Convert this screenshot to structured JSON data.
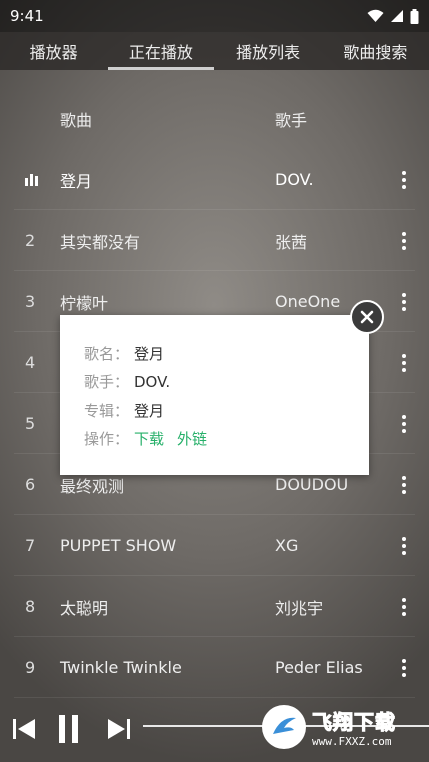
{
  "status_bar": {
    "time": "9:41",
    "icons": [
      "wifi-icon",
      "signal-icon",
      "battery-icon"
    ]
  },
  "tabs": [
    {
      "label": "播放器",
      "active": false
    },
    {
      "label": "正在播放",
      "active": true
    },
    {
      "label": "播放列表",
      "active": false
    },
    {
      "label": "歌曲搜索",
      "active": false
    }
  ],
  "list": {
    "header": {
      "song": "歌曲",
      "artist": "歌手"
    },
    "rows": [
      {
        "index": "",
        "song": "登月",
        "artist": "DOV.",
        "playing": true
      },
      {
        "index": "2",
        "song": "其实都没有",
        "artist": "张茜"
      },
      {
        "index": "3",
        "song": "柠檬叶",
        "artist": "OneOne"
      },
      {
        "index": "4",
        "song": "",
        "artist": ""
      },
      {
        "index": "5",
        "song": "",
        "artist": ""
      },
      {
        "index": "6",
        "song": "最终观测",
        "artist": "DOUDOU"
      },
      {
        "index": "7",
        "song": "PUPPET SHOW",
        "artist": "XG"
      },
      {
        "index": "8",
        "song": "太聪明",
        "artist": "刘兆宇"
      },
      {
        "index": "9",
        "song": "Twinkle Twinkle",
        "artist": "Peder Elias"
      }
    ]
  },
  "popup": {
    "name_label": "歌名：",
    "name": "登月",
    "artist_label": "歌手：",
    "artist": "DOV.",
    "album_label": "专辑：",
    "album": "登月",
    "action_label": "操作：",
    "download": "下载",
    "external_link": "外链"
  },
  "player": {
    "progress": 0.0
  },
  "watermark": {
    "title": "飞翔下载",
    "url": "www.FXXZ.com"
  },
  "colors": {
    "accent": "#27b06a",
    "watermark": "#d94e2a"
  }
}
